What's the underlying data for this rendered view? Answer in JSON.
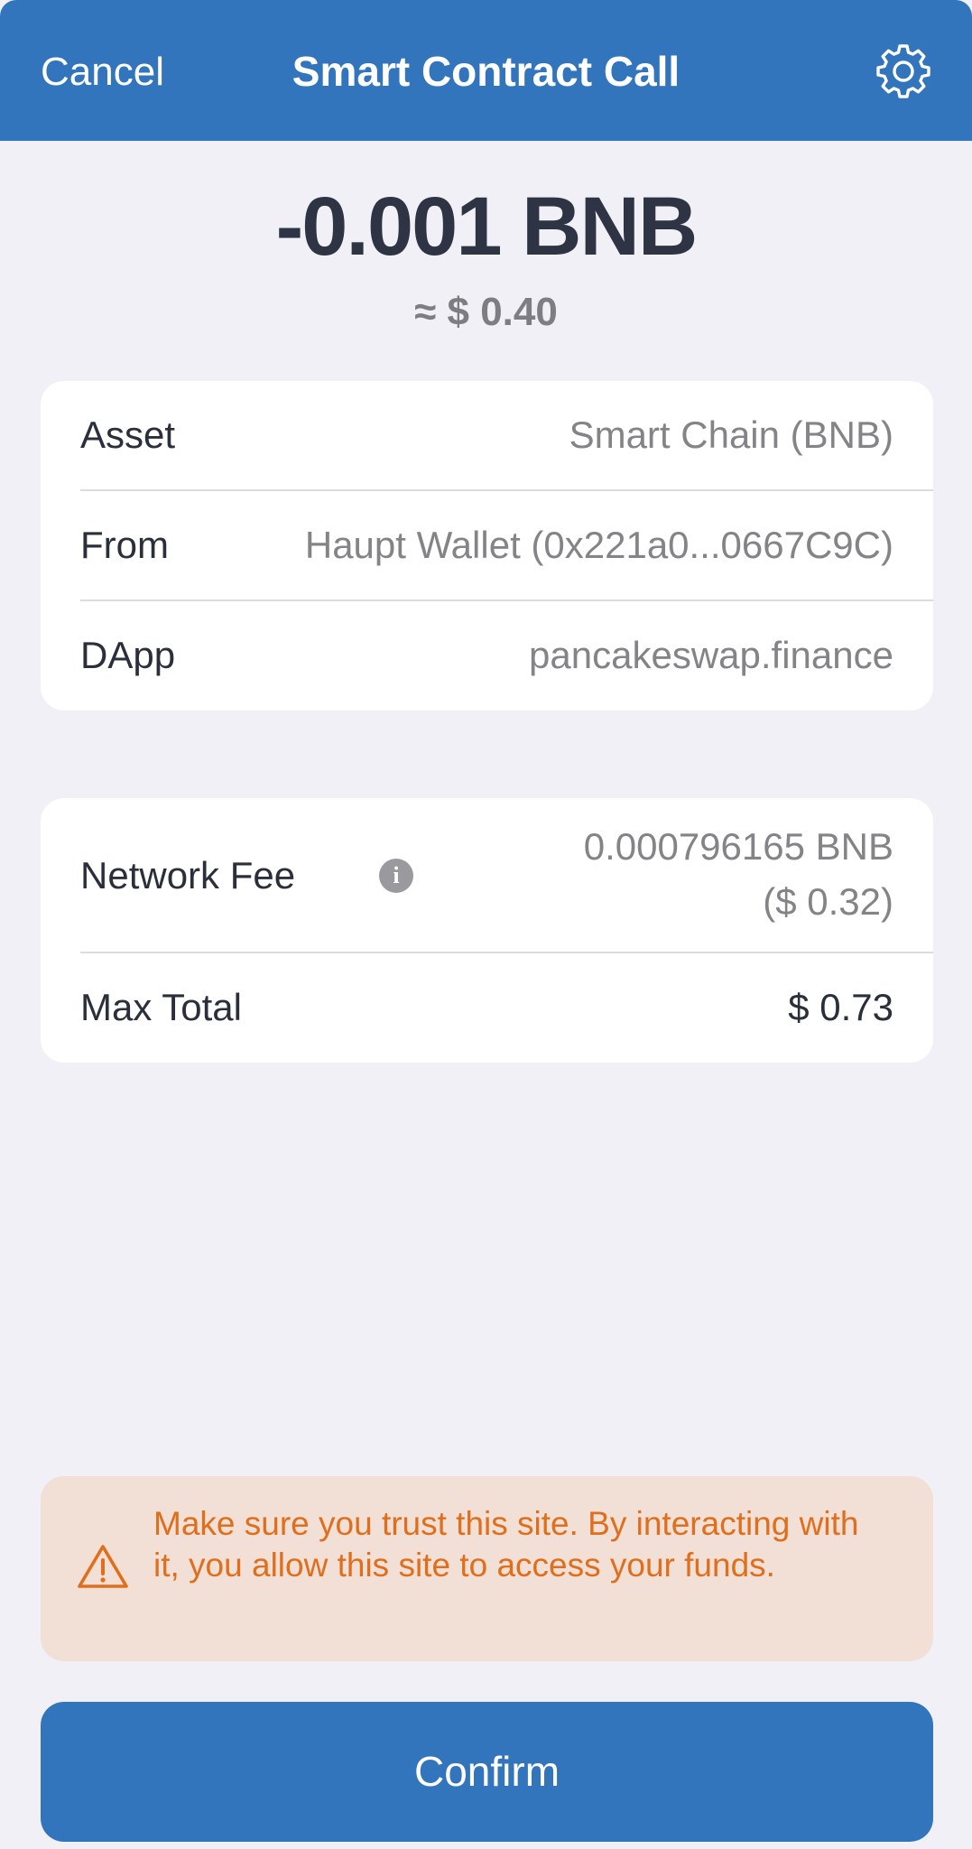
{
  "header": {
    "cancel_label": "Cancel",
    "title": "Smart Contract Call",
    "settings_icon": "gear-icon"
  },
  "summary": {
    "amount": "-0.001 BNB",
    "fiat": "≈ $ 0.40"
  },
  "details": {
    "asset_label": "Asset",
    "asset_value": "Smart Chain (BNB)",
    "from_label": "From",
    "from_value": "Haupt Wallet (0x221a0...0667C9C)",
    "dapp_label": "DApp",
    "dapp_value": "pancakeswap.finance"
  },
  "fees": {
    "network_fee_label": "Network Fee",
    "network_fee_value": "0.000796165 BNB",
    "network_fee_fiat": "($ 0.32)",
    "info_icon": "info-icon",
    "max_total_label": "Max Total",
    "max_total_value": "$ 0.73"
  },
  "warning": {
    "icon": "warning-triangle-icon",
    "text": "Make sure you trust this site. By interacting with it, you allow this site to access your funds."
  },
  "actions": {
    "confirm_label": "Confirm"
  },
  "colors": {
    "primary": "#3275bd",
    "background": "#f0f0f6",
    "warning_bg": "#f2dfd5",
    "warning_text": "#e06f1d",
    "text_dark": "#2b2f3b",
    "text_muted": "#838388"
  }
}
